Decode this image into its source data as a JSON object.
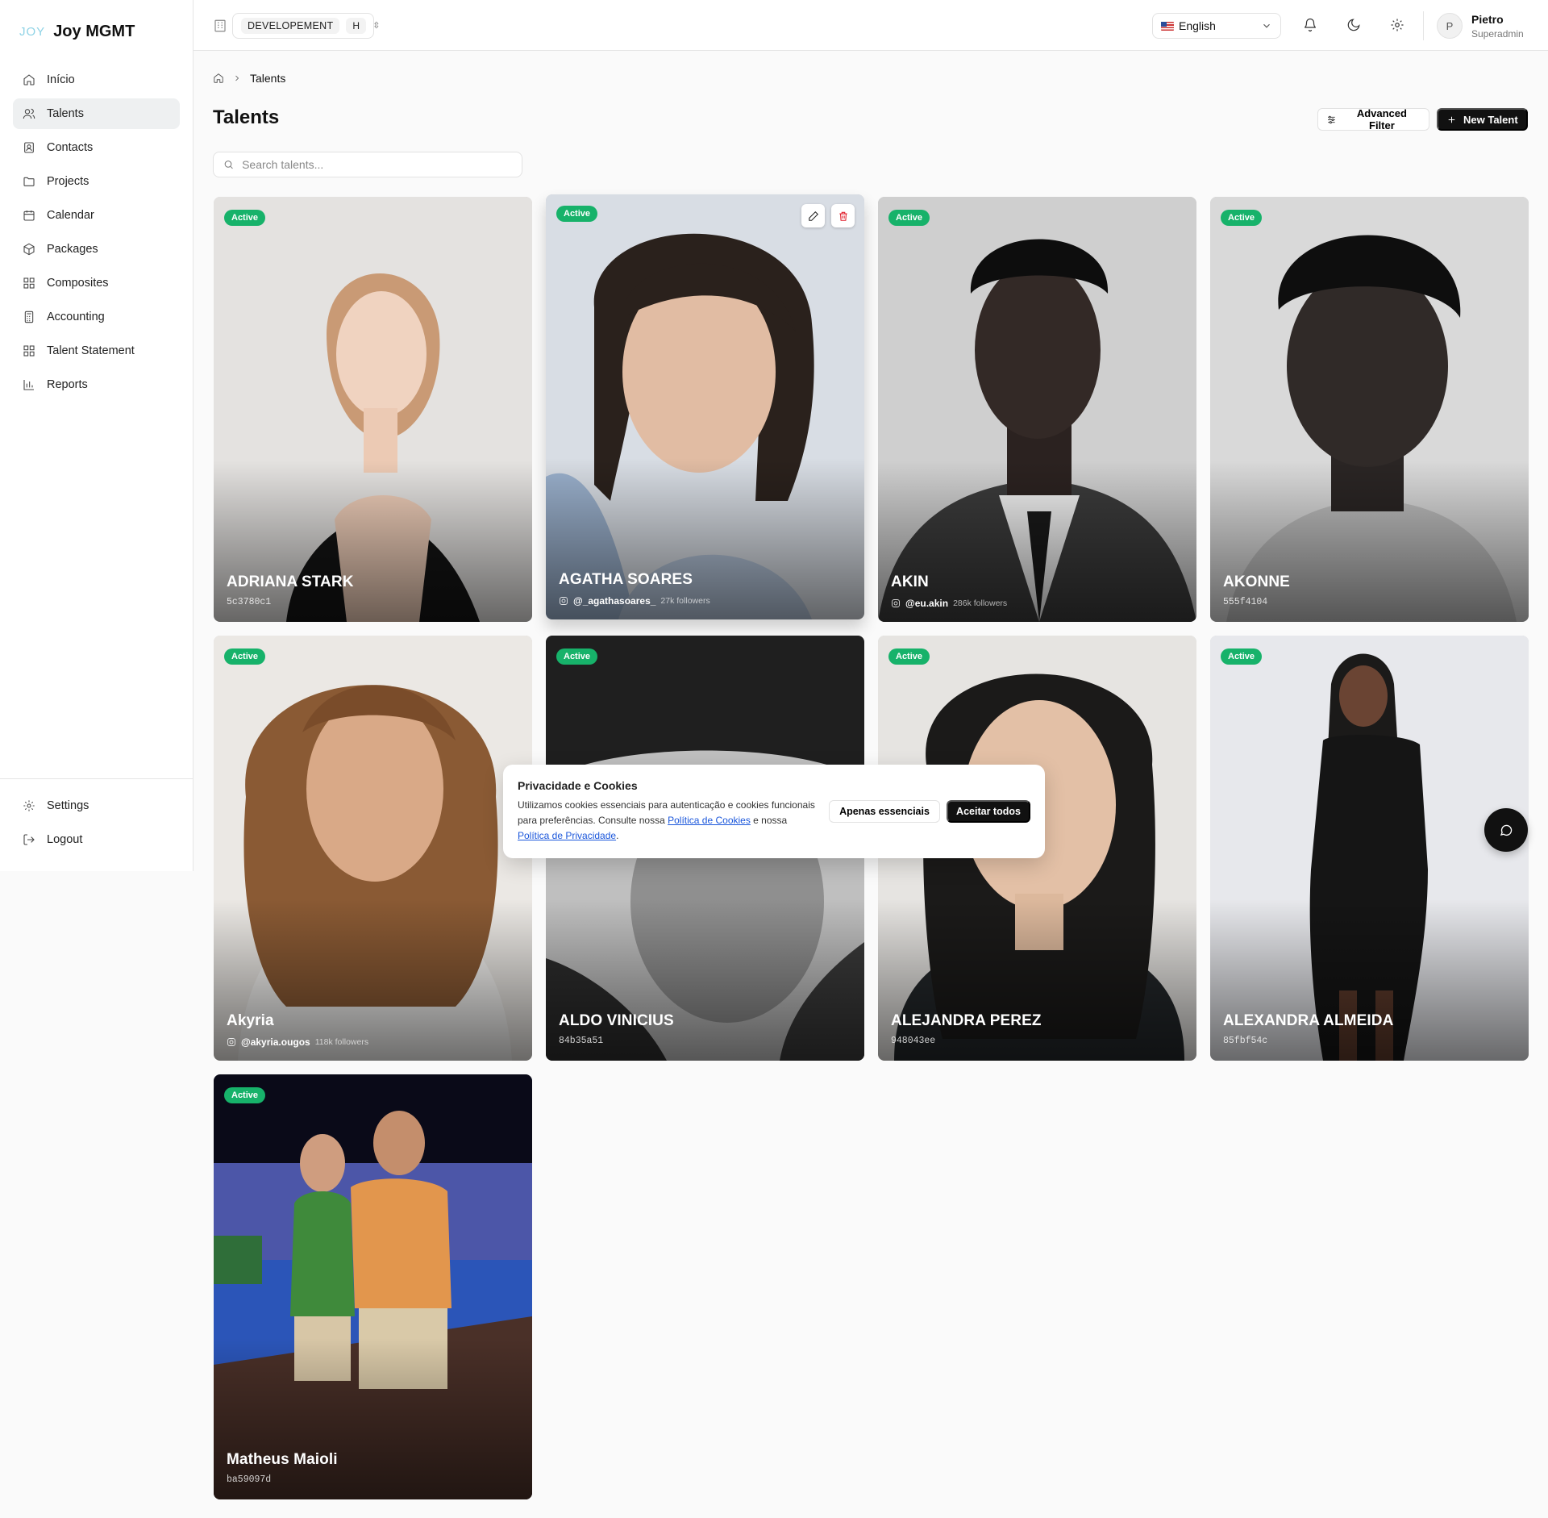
{
  "brand": {
    "mark": "JOY",
    "name": "Joy MGMT"
  },
  "sidebar": {
    "items": [
      {
        "label": "Início",
        "icon": "home-icon"
      },
      {
        "label": "Talents",
        "icon": "users-icon",
        "active": true
      },
      {
        "label": "Contacts",
        "icon": "contact-icon"
      },
      {
        "label": "Projects",
        "icon": "folder-icon"
      },
      {
        "label": "Calendar",
        "icon": "calendar-icon"
      },
      {
        "label": "Packages",
        "icon": "package-icon"
      },
      {
        "label": "Composites",
        "icon": "grid-icon"
      },
      {
        "label": "Accounting",
        "icon": "calculator-icon"
      },
      {
        "label": "Talent Statement",
        "icon": "grid-icon"
      },
      {
        "label": "Reports",
        "icon": "bar-chart-icon"
      }
    ],
    "bottom": [
      {
        "label": "Settings",
        "icon": "gear-icon"
      },
      {
        "label": "Logout",
        "icon": "logout-icon"
      }
    ]
  },
  "topbar": {
    "environment": "DEVELOPEMENT",
    "environment_key": "H",
    "language": "English",
    "user": {
      "initial": "P",
      "name": "Pietro",
      "role": "Superadmin"
    }
  },
  "breadcrumb": {
    "current": "Talents"
  },
  "page": {
    "title": "Talents",
    "advanced_filter_label": "Advanced Filter",
    "new_talent_label": "New Talent",
    "search_placeholder": "Search talents..."
  },
  "talents": [
    {
      "status": "Active",
      "name": "ADRIANA STARK",
      "code": "5c3780c1"
    },
    {
      "status": "Active",
      "name": "AGATHA SOARES",
      "handle": "@_agathasoares_",
      "followers": "27k followers"
    },
    {
      "status": "Active",
      "name": "AKIN",
      "handle": "@eu.akin",
      "followers": "286k followers"
    },
    {
      "status": "Active",
      "name": "AKONNE",
      "code": "555f4104"
    },
    {
      "status": "Active",
      "name": "Akyria",
      "handle": "@akyria.ougos",
      "followers": "118k followers"
    },
    {
      "status": "Active",
      "name": "ALDO VINICIUS",
      "code": "84b35a51"
    },
    {
      "status": "Active",
      "name": "ALEJANDRA PEREZ",
      "code": "948043ee"
    },
    {
      "status": "Active",
      "name": "ALEXANDRA ALMEIDA",
      "code": "85fbf54c"
    },
    {
      "status": "Active",
      "name": "Matheus Maioli",
      "code": "ba59097d"
    }
  ],
  "cookie_banner": {
    "title": "Privacidade e Cookies",
    "text_1": "Utilizamos cookies essenciais para autenticação e cookies funcionais para preferências. Consulte nossa ",
    "link_1": "Política de Cookies",
    "text_2": " e nossa ",
    "link_2": "Política de Privacidade",
    "text_3": ".",
    "essential_label": "Apenas essenciais",
    "accept_label": "Aceitar todos"
  },
  "colors": {
    "accent": "#111111",
    "status_active": "#17b26a",
    "danger": "#e11d2a",
    "link": "#1a56db"
  }
}
